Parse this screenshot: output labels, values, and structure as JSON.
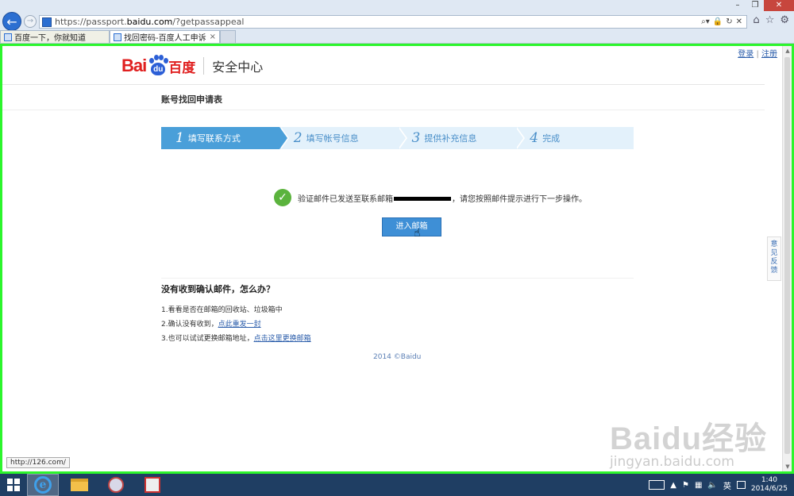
{
  "browser": {
    "url_prefix": "https://passport.",
    "url_domain": "baidu.com",
    "url_path": "/?getpassappeal",
    "tabs": [
      {
        "title": "百度一下，你就知道"
      },
      {
        "title": "找回密码-百度人工申诉"
      }
    ],
    "tab_close": "×",
    "status_url": "http://126.com/"
  },
  "page": {
    "top_links": {
      "login": "登录",
      "sep": " | ",
      "register": "注册"
    },
    "logo": {
      "bai": "Bai",
      "du": "du",
      "cn": "百度",
      "section": "安全中心"
    },
    "form_title": "账号找回申请表",
    "steps": [
      {
        "num": "1",
        "label": "填写联系方式"
      },
      {
        "num": "2",
        "label": "填写帐号信息"
      },
      {
        "num": "3",
        "label": "提供补充信息"
      },
      {
        "num": "4",
        "label": "完成"
      }
    ],
    "message_prefix": "验证邮件已发送至联系邮箱",
    "message_suffix": "，请您按照邮件提示进行下一步操作。",
    "enter_mailbox": "进入邮箱",
    "faq_title": "没有收到确认邮件，怎么办？",
    "faq": [
      {
        "text": "1.看看是否在邮箱的回收站、垃圾箱中",
        "link": ""
      },
      {
        "text": "2.确认没有收到，",
        "link": "点此重发一封"
      },
      {
        "text": "3.也可以试试更换邮箱地址，",
        "link": "点击这里更换邮箱"
      }
    ],
    "copyright": "2014 ©Baidu",
    "feedback": "意见反馈"
  },
  "watermark": {
    "big": "Baidu经验",
    "small": "jingyan.baidu.com"
  },
  "taskbar": {
    "ime": "英",
    "time": "1:40",
    "date": "2014/6/25"
  },
  "colors": {
    "highlight": "#2cf52c",
    "step_active": "#4a9fd9",
    "step_inactive": "#e3f1fb",
    "success": "#5bb33d",
    "primary_button": "#3e8fd6"
  }
}
